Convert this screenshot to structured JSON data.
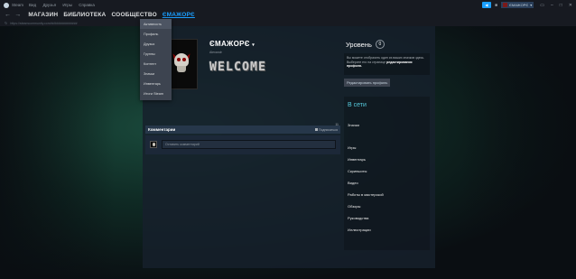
{
  "titlebar": {
    "app": "Steam",
    "menu": [
      "Вид",
      "Друзья",
      "Игры",
      "Справка"
    ],
    "username": "ЄMAЖOPЄ"
  },
  "nav": {
    "links": [
      "МАГАЗИН",
      "БИБЛИОТЕКА",
      "СООБЩЕСТВО",
      "ЄMAЖOPЄ"
    ],
    "active_index": 3
  },
  "urlbar": {
    "url": "https://steamcommunity.com/id/#############"
  },
  "dropdown": {
    "items": [
      "Активность",
      "Профиль",
      "Друзья",
      "Группы",
      "Контент",
      "Значки",
      "Инвентарь",
      "Итоги Steam"
    ]
  },
  "profile": {
    "name": "ЄMAЖOPЄ",
    "subname": "Alexandr",
    "showcase_text": "WELCOME"
  },
  "level": {
    "label": "Уровень",
    "value": "0"
  },
  "showcase_info": {
    "text": "Вы можете отобразить один из ваших значков здесь. Выберите его на странице",
    "link": "редактирования профиля."
  },
  "edit_button": "Редактировать профиль",
  "status": {
    "online": "В сети",
    "links": [
      "Значки",
      "Игры",
      "Инвентарь",
      "Скриншоты",
      "Видео",
      "Работы в мастерской",
      "Обзоры",
      "Руководства",
      "Иллюстрации"
    ]
  },
  "comments": {
    "title": "Комментарии",
    "subscribe": "Подписаться",
    "count": "11",
    "placeholder": "Оставить комментарий"
  },
  "colors": {
    "accent": "#1a9fff",
    "online": "#57cbde",
    "panel": "#16202c"
  }
}
